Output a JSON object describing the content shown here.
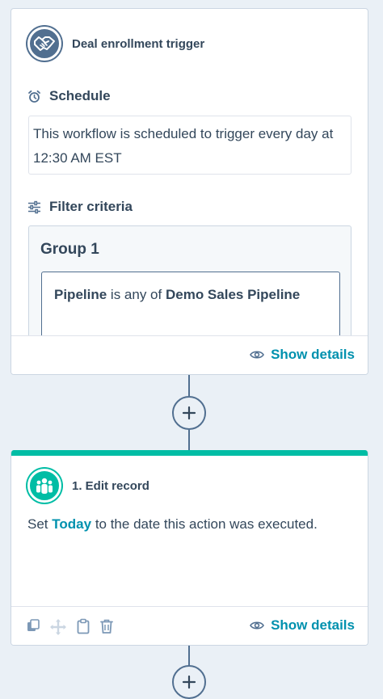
{
  "trigger": {
    "title": "Deal enrollment trigger",
    "schedule_label": "Schedule",
    "schedule_text": "This workflow is scheduled to trigger every day at 12:30 AM EST",
    "filter_label": "Filter criteria",
    "group_title": "Group 1",
    "criteria": {
      "property": "Pipeline",
      "operator": "is any of",
      "value": "Demo Sales Pipeline"
    },
    "show_details": "Show details"
  },
  "action": {
    "title": "1. Edit record",
    "desc_prefix": "Set",
    "desc_link": "Today",
    "desc_suffix": "to the date this action was executed.",
    "show_details": "Show details",
    "tools": [
      "copy-icon",
      "move-icon",
      "clipboard-icon",
      "trash-icon"
    ]
  },
  "colors": {
    "accent_teal": "#00bda5",
    "link": "#0091ae",
    "slate": "#516f90",
    "text": "#33475b",
    "background": "#eaf0f6"
  }
}
